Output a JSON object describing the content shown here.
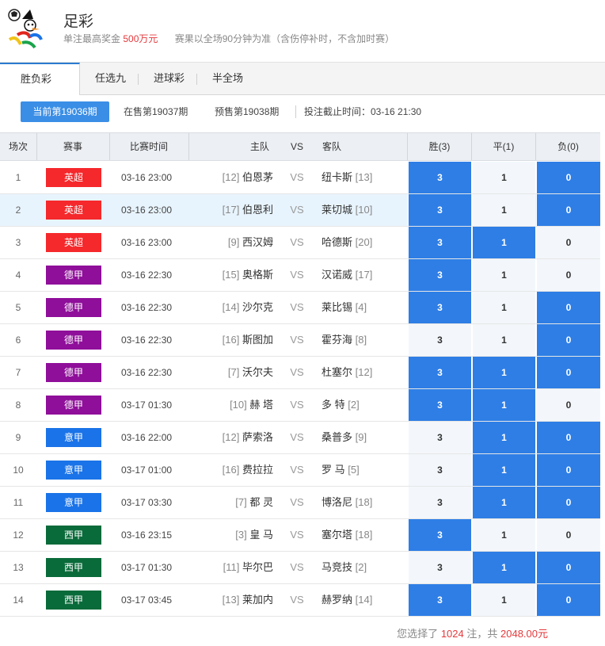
{
  "header": {
    "title": "足彩",
    "prize_prefix": "单注最高奖金",
    "prize_value": "500万元",
    "rule_text": "赛果以全场90分钟为准（含伤停补时，不含加时赛）"
  },
  "tabs": [
    {
      "label": "胜负彩",
      "active": true
    },
    {
      "label": "任选九",
      "active": false
    },
    {
      "label": "进球彩",
      "active": false
    },
    {
      "label": "半全场",
      "active": false
    }
  ],
  "periods": {
    "current": "当前第19036期",
    "on_sale": "在售第19037期",
    "presale": "预售第19038期",
    "deadline": "投注截止时间：03-16 21:30"
  },
  "table": {
    "headers": {
      "no": "场次",
      "league": "赛事",
      "time": "比赛时间",
      "home": "主队",
      "vs": "VS",
      "away": "客队",
      "win": "胜(3)",
      "draw": "平(1)",
      "loss": "负(0)"
    },
    "league_colors": {
      "英超": "#f5282b",
      "德甲": "#8f0e9a",
      "意甲": "#1a73e8",
      "西甲": "#0a6b3a"
    },
    "rows": [
      {
        "no": "1",
        "league": "英超",
        "time": "03-16 23:00",
        "home_rank": "[12]",
        "home": "伯恩茅",
        "vs": "VS",
        "away": "纽卡斯",
        "away_rank": "[13]",
        "win": "3",
        "draw": "1",
        "loss": "0",
        "sel": [
          true,
          false,
          true
        ]
      },
      {
        "no": "2",
        "league": "英超",
        "time": "03-16 23:00",
        "home_rank": "[17]",
        "home": "伯恩利",
        "vs": "VS",
        "away": "莱切城",
        "away_rank": "[10]",
        "win": "3",
        "draw": "1",
        "loss": "0",
        "sel": [
          true,
          false,
          true
        ]
      },
      {
        "no": "3",
        "league": "英超",
        "time": "03-16 23:00",
        "home_rank": "[9]",
        "home": "西汉姆",
        "vs": "VS",
        "away": "哈德斯",
        "away_rank": "[20]",
        "win": "3",
        "draw": "1",
        "loss": "0",
        "sel": [
          true,
          true,
          false
        ]
      },
      {
        "no": "4",
        "league": "德甲",
        "time": "03-16 22:30",
        "home_rank": "[15]",
        "home": "奥格斯",
        "vs": "VS",
        "away": "汉诺威",
        "away_rank": "[17]",
        "win": "3",
        "draw": "1",
        "loss": "0",
        "sel": [
          true,
          false,
          false
        ]
      },
      {
        "no": "5",
        "league": "德甲",
        "time": "03-16 22:30",
        "home_rank": "[14]",
        "home": "沙尔克",
        "vs": "VS",
        "away": "莱比锡",
        "away_rank": "[4]",
        "win": "3",
        "draw": "1",
        "loss": "0",
        "sel": [
          true,
          false,
          true
        ]
      },
      {
        "no": "6",
        "league": "德甲",
        "time": "03-16 22:30",
        "home_rank": "[16]",
        "home": "斯图加",
        "vs": "VS",
        "away": "霍芬海",
        "away_rank": "[8]",
        "win": "3",
        "draw": "1",
        "loss": "0",
        "sel": [
          false,
          false,
          true
        ]
      },
      {
        "no": "7",
        "league": "德甲",
        "time": "03-16 22:30",
        "home_rank": "[7]",
        "home": "沃尔夫",
        "vs": "VS",
        "away": "杜塞尔",
        "away_rank": "[12]",
        "win": "3",
        "draw": "1",
        "loss": "0",
        "sel": [
          true,
          true,
          true
        ]
      },
      {
        "no": "8",
        "league": "德甲",
        "time": "03-17 01:30",
        "home_rank": "[10]",
        "home": "赫 塔",
        "vs": "VS",
        "away": "多 特",
        "away_rank": "[2]",
        "win": "3",
        "draw": "1",
        "loss": "0",
        "sel": [
          true,
          true,
          false
        ]
      },
      {
        "no": "9",
        "league": "意甲",
        "time": "03-16 22:00",
        "home_rank": "[12]",
        "home": "萨索洛",
        "vs": "VS",
        "away": "桑普多",
        "away_rank": "[9]",
        "win": "3",
        "draw": "1",
        "loss": "0",
        "sel": [
          false,
          true,
          true
        ]
      },
      {
        "no": "10",
        "league": "意甲",
        "time": "03-17 01:00",
        "home_rank": "[16]",
        "home": "费拉拉",
        "vs": "VS",
        "away": "罗 马",
        "away_rank": "[5]",
        "win": "3",
        "draw": "1",
        "loss": "0",
        "sel": [
          false,
          true,
          true
        ]
      },
      {
        "no": "11",
        "league": "意甲",
        "time": "03-17 03:30",
        "home_rank": "[7]",
        "home": "都 灵",
        "vs": "VS",
        "away": "博洛尼",
        "away_rank": "[18]",
        "win": "3",
        "draw": "1",
        "loss": "0",
        "sel": [
          false,
          true,
          true
        ]
      },
      {
        "no": "12",
        "league": "西甲",
        "time": "03-16 23:15",
        "home_rank": "[3]",
        "home": "皇 马",
        "vs": "VS",
        "away": "塞尔塔",
        "away_rank": "[18]",
        "win": "3",
        "draw": "1",
        "loss": "0",
        "sel": [
          true,
          false,
          false
        ]
      },
      {
        "no": "13",
        "league": "西甲",
        "time": "03-17 01:30",
        "home_rank": "[11]",
        "home": "毕尔巴",
        "vs": "VS",
        "away": "马竞技",
        "away_rank": "[2]",
        "win": "3",
        "draw": "1",
        "loss": "0",
        "sel": [
          false,
          true,
          true
        ]
      },
      {
        "no": "14",
        "league": "西甲",
        "time": "03-17 03:45",
        "home_rank": "[13]",
        "home": "莱加内",
        "vs": "VS",
        "away": "赫罗纳",
        "away_rank": "[14]",
        "win": "3",
        "draw": "1",
        "loss": "0",
        "sel": [
          true,
          false,
          true
        ]
      }
    ]
  },
  "footer": {
    "prefix": "您选择了",
    "count": "1024",
    "mid": "注，共",
    "amount": "2048.00元"
  }
}
